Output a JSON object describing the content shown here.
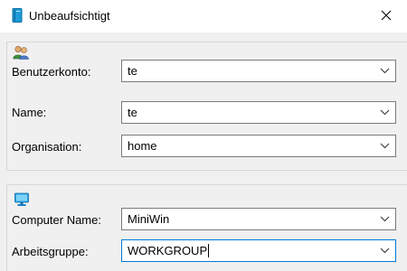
{
  "window": {
    "title": "Unbeaufsichtigt",
    "close_icon": "close-icon",
    "app_icon": "book-icon"
  },
  "user_section": {
    "icon": "users-icon",
    "fields": [
      {
        "label": "Benutzerkonto:",
        "value": "te"
      },
      {
        "label": "Name:",
        "value": "te"
      },
      {
        "label": "Organisation:",
        "value": "home"
      }
    ]
  },
  "computer_section": {
    "icon": "computer-icon",
    "fields": [
      {
        "label": "Computer Name:",
        "value": "MiniWin"
      },
      {
        "label": "Arbeitsgruppe:",
        "value": "WORKGROUP"
      }
    ]
  },
  "colors": {
    "window_bg": "#f0f0f0",
    "titlebar_bg": "#ffffff",
    "focus_border": "#0078d7",
    "input_border": "#7a7a7a",
    "group_border": "#d8d8d8"
  }
}
